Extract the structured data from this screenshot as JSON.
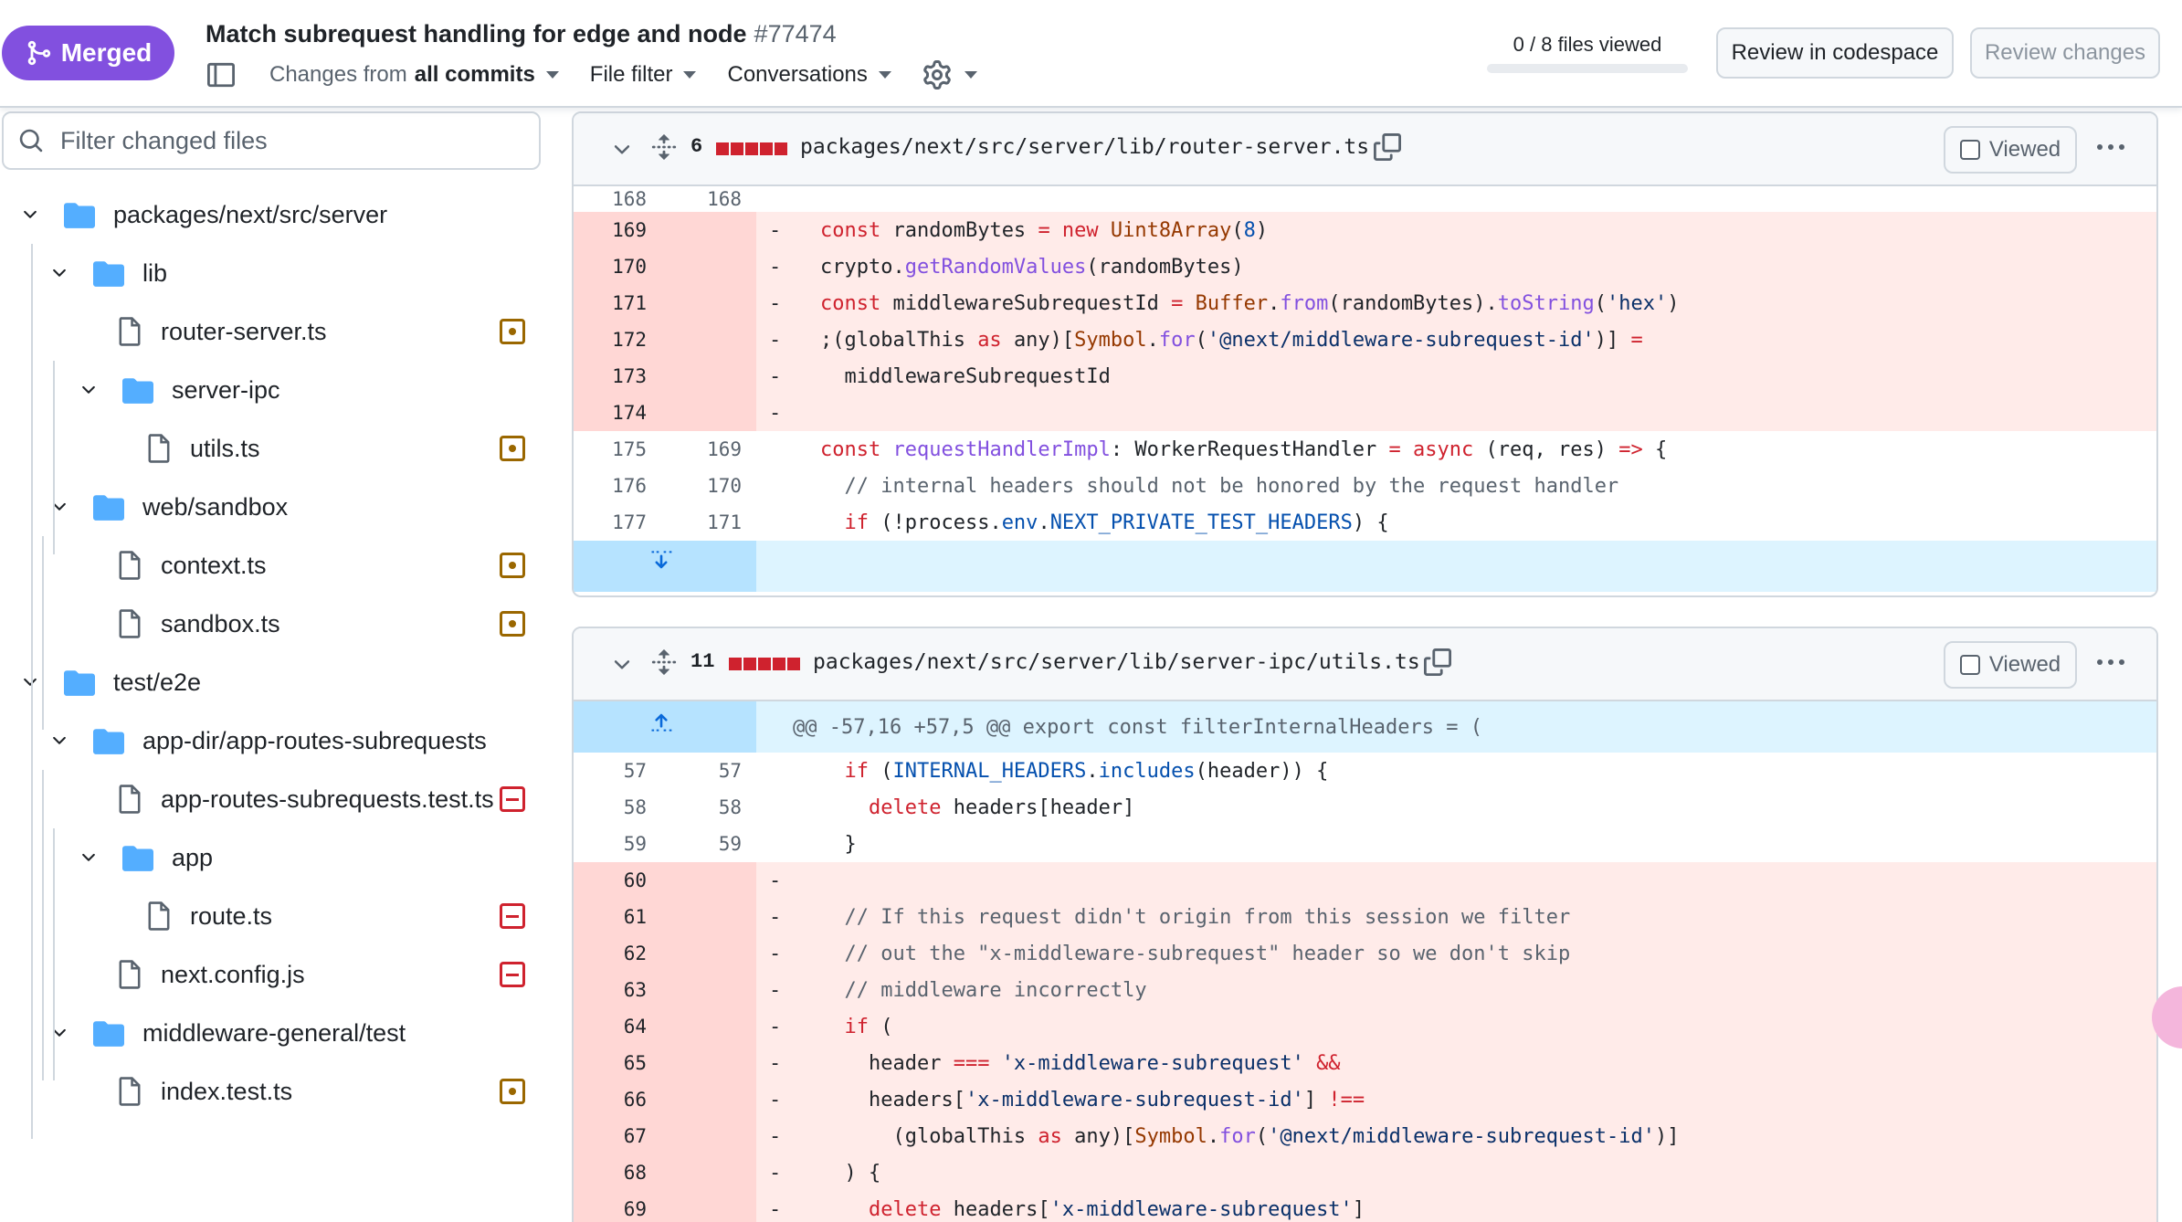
{
  "header": {
    "status": "Merged",
    "title": "Match subrequest handling for edge and node",
    "number": "#77474",
    "changes_from_prefix": "Changes from",
    "changes_from_value": "all commits",
    "file_filter": "File filter",
    "conversations": "Conversations",
    "files_viewed": "0 / 8 files viewed",
    "files_viewed_fraction": 0,
    "review_codespace": "Review in codespace",
    "review_changes": "Review changes"
  },
  "sidebar": {
    "filter_placeholder": "Filter changed files",
    "tree": [
      {
        "label": "packages/next/src/server",
        "kind": "folder",
        "level": 0
      },
      {
        "label": "lib",
        "kind": "folder",
        "level": 1
      },
      {
        "label": "router-server.ts",
        "kind": "file",
        "level": 2,
        "status": "modified"
      },
      {
        "label": "server-ipc",
        "kind": "folder",
        "level": 2
      },
      {
        "label": "utils.ts",
        "kind": "file",
        "level": 3,
        "status": "modified"
      },
      {
        "label": "web/sandbox",
        "kind": "folder",
        "level": 1
      },
      {
        "label": "context.ts",
        "kind": "file",
        "level": 2,
        "status": "modified"
      },
      {
        "label": "sandbox.ts",
        "kind": "file",
        "level": 2,
        "status": "modified"
      },
      {
        "label": "test/e2e",
        "kind": "folder",
        "level": 0
      },
      {
        "label": "app-dir/app-routes-subrequests",
        "kind": "folder",
        "level": 1
      },
      {
        "label": "app-routes-subrequests.test.ts",
        "kind": "file",
        "level": 2,
        "status": "deleted"
      },
      {
        "label": "app",
        "kind": "folder",
        "level": 2
      },
      {
        "label": "route.ts",
        "kind": "file",
        "level": 3,
        "status": "deleted"
      },
      {
        "label": "next.config.js",
        "kind": "file",
        "level": 2,
        "status": "deleted"
      },
      {
        "label": "middleware-general/test",
        "kind": "folder",
        "level": 1
      },
      {
        "label": "index.test.ts",
        "kind": "file",
        "level": 2,
        "status": "modified"
      }
    ]
  },
  "diffs": [
    {
      "count": "6",
      "path": "packages/next/src/server/lib/router-server.ts",
      "viewed_label": "Viewed",
      "lines": [
        {
          "type": "ctx",
          "old": "168",
          "new": "168",
          "code": []
        },
        {
          "type": "del",
          "old": "169",
          "new": "",
          "code": [
            [
              "k",
              "const "
            ],
            [
              "",
              "randomBytes "
            ],
            [
              "k",
              "= new "
            ],
            [
              "v",
              "Uint8Array"
            ],
            [
              "",
              "("
            ],
            [
              "b",
              "8"
            ],
            [
              "",
              ")"
            ]
          ]
        },
        {
          "type": "del",
          "old": "170",
          "new": "",
          "code": [
            [
              "",
              "crypto."
            ],
            [
              "f",
              "getRandomValues"
            ],
            [
              "",
              "(randomBytes)"
            ]
          ]
        },
        {
          "type": "del",
          "old": "171",
          "new": "",
          "code": [
            [
              "k",
              "const "
            ],
            [
              "",
              "middlewareSubrequestId "
            ],
            [
              "k",
              "= "
            ],
            [
              "v",
              "Buffer"
            ],
            [
              "",
              "."
            ],
            [
              "f",
              "from"
            ],
            [
              "",
              "(randomBytes)."
            ],
            [
              "f",
              "toString"
            ],
            [
              "",
              "("
            ],
            [
              "s",
              "'hex'"
            ],
            [
              "",
              ")"
            ]
          ]
        },
        {
          "type": "del",
          "old": "172",
          "new": "",
          "code": [
            [
              "",
              ";(globalThis "
            ],
            [
              "k",
              "as "
            ],
            [
              "",
              "any)["
            ],
            [
              "v",
              "Symbol"
            ],
            [
              "",
              "."
            ],
            [
              "f",
              "for"
            ],
            [
              "",
              "("
            ],
            [
              "s",
              "'@next/middleware-subrequest-id'"
            ],
            [
              "",
              ")] "
            ],
            [
              "k",
              "="
            ]
          ]
        },
        {
          "type": "del",
          "old": "173",
          "new": "",
          "code": [
            [
              "",
              "  middlewareSubrequestId"
            ]
          ]
        },
        {
          "type": "del",
          "old": "174",
          "new": "",
          "code": []
        },
        {
          "type": "ctx",
          "old": "175",
          "new": "169",
          "code": [
            [
              "k",
              "const "
            ],
            [
              "f",
              "requestHandlerImpl"
            ],
            [
              "",
              ": WorkerRequestHandler "
            ],
            [
              "k",
              "= async "
            ],
            [
              "",
              "(req, res) "
            ],
            [
              "k",
              "=> "
            ],
            [
              "",
              "{"
            ]
          ]
        },
        {
          "type": "ctx",
          "old": "176",
          "new": "170",
          "code": [
            [
              "c",
              "  // internal headers should not be honored by the request handler"
            ]
          ]
        },
        {
          "type": "ctx",
          "old": "177",
          "new": "171",
          "code": [
            [
              "k",
              "  if "
            ],
            [
              "",
              "(!process."
            ],
            [
              "b",
              "env"
            ],
            [
              "",
              "."
            ],
            [
              "b",
              "NEXT_PRIVATE_TEST_HEADERS"
            ],
            [
              "",
              ") {"
            ]
          ]
        },
        {
          "type": "hunk-bottom",
          "old": "",
          "new": "",
          "code": []
        }
      ]
    },
    {
      "count": "11",
      "path": "packages/next/src/server/lib/server-ipc/utils.ts",
      "viewed_label": "Viewed",
      "lines": [
        {
          "type": "hunk",
          "old": "",
          "new": "",
          "code": [
            [
              "",
              "@@ -57,16 +57,5 @@ export const filterInternalHeaders = ("
            ]
          ]
        },
        {
          "type": "ctx",
          "old": "57",
          "new": "57",
          "code": [
            [
              "k",
              "  if "
            ],
            [
              "",
              "("
            ],
            [
              "b",
              "INTERNAL_HEADERS"
            ],
            [
              "",
              "."
            ],
            [
              "b",
              "includes"
            ],
            [
              "",
              "(header)) {"
            ]
          ]
        },
        {
          "type": "ctx",
          "old": "58",
          "new": "58",
          "code": [
            [
              "k",
              "    delete "
            ],
            [
              "",
              "headers[header]"
            ]
          ]
        },
        {
          "type": "ctx",
          "old": "59",
          "new": "59",
          "code": [
            [
              "",
              "  }"
            ]
          ]
        },
        {
          "type": "del",
          "old": "60",
          "new": "",
          "code": []
        },
        {
          "type": "del",
          "old": "61",
          "new": "",
          "code": [
            [
              "c",
              "  // If this request didn't origin from this session we filter"
            ]
          ]
        },
        {
          "type": "del",
          "old": "62",
          "new": "",
          "code": [
            [
              "c",
              "  // out the \"x-middleware-subrequest\" header so we don't skip"
            ]
          ]
        },
        {
          "type": "del",
          "old": "63",
          "new": "",
          "code": [
            [
              "c",
              "  // middleware incorrectly"
            ]
          ]
        },
        {
          "type": "del",
          "old": "64",
          "new": "",
          "code": [
            [
              "k",
              "  if "
            ],
            [
              "",
              "("
            ]
          ]
        },
        {
          "type": "del",
          "old": "65",
          "new": "",
          "code": [
            [
              "",
              "    header "
            ],
            [
              "k",
              "=== "
            ],
            [
              "s",
              "'x-middleware-subrequest' "
            ],
            [
              "k",
              "&&"
            ]
          ]
        },
        {
          "type": "del",
          "old": "66",
          "new": "",
          "code": [
            [
              "",
              "    headers["
            ],
            [
              "s",
              "'x-middleware-subrequest-id'"
            ],
            [
              "",
              "] "
            ],
            [
              "k",
              "!=="
            ]
          ]
        },
        {
          "type": "del",
          "old": "67",
          "new": "",
          "code": [
            [
              "",
              "      (globalThis "
            ],
            [
              "k",
              "as "
            ],
            [
              "",
              "any)["
            ],
            [
              "v",
              "Symbol"
            ],
            [
              "",
              "."
            ],
            [
              "f",
              "for"
            ],
            [
              "",
              "("
            ],
            [
              "s",
              "'@next/middleware-subrequest-id'"
            ],
            [
              "",
              ")]"
            ]
          ]
        },
        {
          "type": "del",
          "old": "68",
          "new": "",
          "code": [
            [
              "",
              "  ) {"
            ]
          ]
        },
        {
          "type": "del",
          "old": "69",
          "new": "",
          "code": [
            [
              "k",
              "    delete "
            ],
            [
              "",
              "headers["
            ],
            [
              "s",
              "'x-middleware-subrequest'"
            ],
            [
              "",
              "]"
            ]
          ]
        }
      ]
    }
  ],
  "colors": {
    "merged": "#8250df",
    "deleted_line_bg": "#ffebe9",
    "deleted_gutter_bg": "#ffd7d5",
    "hunk_bg": "#ddf4ff",
    "status_modified": "#9a6700",
    "status_deleted": "#cf222e"
  },
  "icons": [
    "git-merge-icon",
    "sidebar-toggle-icon",
    "gear-icon",
    "search-icon",
    "chevron-down-icon",
    "folder-icon",
    "file-icon",
    "expand-icon",
    "copy-icon",
    "kebab-icon"
  ]
}
